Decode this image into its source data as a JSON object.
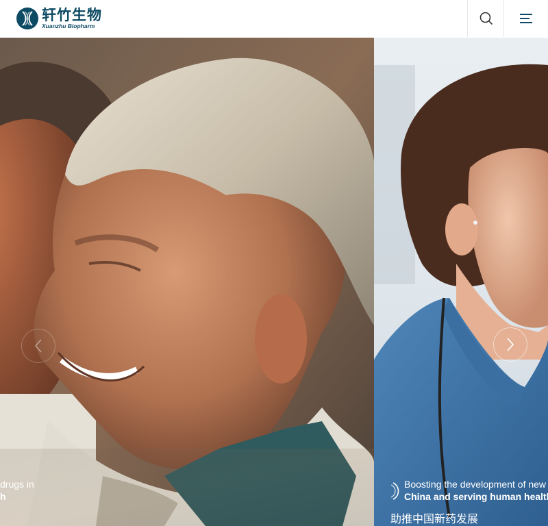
{
  "header": {
    "logo_cn": "轩竹生物",
    "logo_en": "Xuanzhu Biopharm",
    "search_icon": "search-icon",
    "menu_icon": "hamburger-menu-icon",
    "brand_color": "#0d4a63"
  },
  "slider": {
    "slides": [
      {
        "caption_line1": "drugs in",
        "caption_line2": "h"
      },
      {
        "caption_line1": "Boosting the development of new",
        "caption_line2": "China and serving human health",
        "caption_cn": "助推中国新药发展"
      }
    ],
    "prev_icon": "chevron-left-icon",
    "next_icon": "chevron-right-icon"
  }
}
